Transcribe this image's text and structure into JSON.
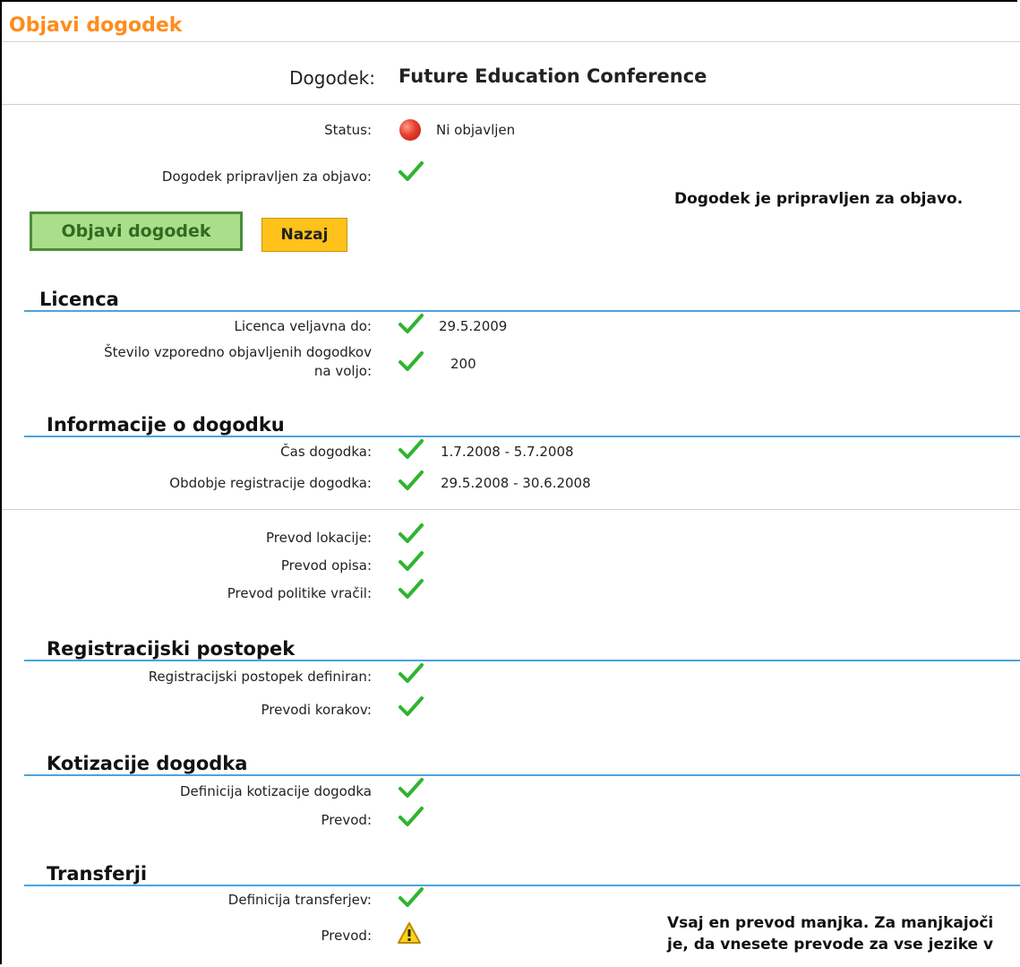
{
  "header": {
    "title": "Objavi dogodek"
  },
  "event": {
    "label": "Dogodek:",
    "name": "Future Education Conference"
  },
  "status": {
    "label": "Status:",
    "value": "Ni objavljen"
  },
  "ready": {
    "label": "Dogodek pripravljen za objavo:",
    "message": "Dogodek je pripravljen za objavo."
  },
  "buttons": {
    "publish": "Objavi dogodek",
    "back": "Nazaj"
  },
  "licence": {
    "title": "Licenca",
    "valid_label": "Licenca veljavna do:",
    "valid_value": "29.5.2009",
    "count_label_1": "Število vzporedno objavljenih dogodkov",
    "count_label_2": "na voljo:",
    "count_value": "200"
  },
  "info": {
    "title": "Informacije o dogodku",
    "time_label": "Čas dogodka:",
    "time_value": "1.7.2008 - 5.7.2008",
    "reg_label": "Obdobje registracije dogodka:",
    "reg_value": "29.5.2008 - 30.6.2008",
    "loc_label": "Prevod lokacije:",
    "desc_label": "Prevod opisa:",
    "refund_label": "Prevod politike vračil:"
  },
  "registration": {
    "title": "Registracijski postopek",
    "defined_label": "Registracijski postopek definiran:",
    "steps_label": "Prevodi korakov:"
  },
  "fees": {
    "title": "Kotizacije dogodka",
    "def_label": "Definicija kotizacije dogodka",
    "trans_label": "Prevod:"
  },
  "transfers": {
    "title": "Transferji",
    "def_label": "Definicija transferjev:",
    "trans_label": "Prevod:",
    "warn_line1": "Vsaj en prevod manjka. Za manjkajoči",
    "warn_line2": "je, da vnesete prevode za vse jezike v"
  },
  "colors": {
    "title_orange": "#ff8c1a",
    "section_line": "#4da3dd",
    "check_green": "#2fb52f",
    "publish_bg": "#a9df8a",
    "back_bg": "#ffc21a"
  }
}
